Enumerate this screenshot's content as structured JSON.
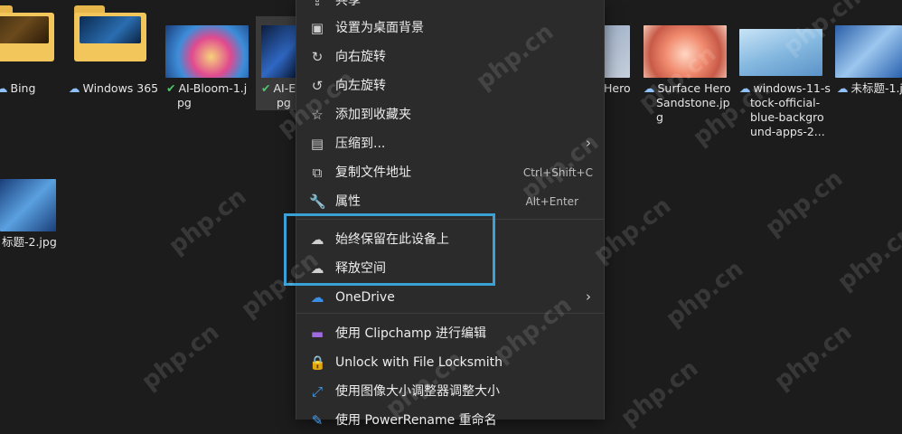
{
  "files": [
    {
      "name": "Bing",
      "icon": "cloud"
    },
    {
      "name": "Windows 365",
      "icon": "cloud"
    },
    {
      "name": "AI-Bloom-1.j",
      "name2": "pg",
      "icon": "check"
    },
    {
      "name": "AI-E",
      "name2": "pg",
      "icon": "check"
    },
    {
      "name": "Hero",
      "icon": ""
    },
    {
      "name": "Surface Hero",
      "name2": "Sandstone.jp",
      "name3": "g",
      "icon": "cloud"
    },
    {
      "name": "windows-11-s",
      "name2": "tock-official-",
      "name3": "blue-backgro",
      "name4": "und-apps-2...",
      "icon": "cloud"
    },
    {
      "name": "未标题-1.j",
      "icon": "cloud"
    },
    {
      "name": "标题-2.jpg",
      "icon": ""
    }
  ],
  "menu": {
    "items": [
      {
        "label": "共享",
        "icon": "share-icon"
      },
      {
        "label": "设置为桌面背景",
        "icon": "wallpaper-icon"
      },
      {
        "label": "向右旋转",
        "icon": "rotate-right-icon"
      },
      {
        "label": "向左旋转",
        "icon": "rotate-left-icon"
      },
      {
        "label": "添加到收藏夹",
        "icon": "star-icon"
      },
      {
        "label": "压缩到...",
        "icon": "zip-icon"
      },
      {
        "label": "复制文件地址",
        "icon": "copy-path-icon",
        "shortcut": "Ctrl+Shift+C"
      },
      {
        "label": "属性",
        "icon": "wrench-icon",
        "shortcut": "Alt+Enter"
      },
      {
        "label": "始终保留在此设备上",
        "icon": "cloud-pin-icon"
      },
      {
        "label": "释放空间",
        "icon": "cloud-icon"
      },
      {
        "label": "OneDrive",
        "icon": "onedrive-icon"
      },
      {
        "label": "使用 Clipchamp 进行编辑",
        "icon": "clipchamp-icon"
      },
      {
        "label": "Unlock with File Locksmith",
        "icon": "lock-icon"
      },
      {
        "label": "使用图像大小调整器调整大小",
        "icon": "resize-icon"
      },
      {
        "label": "使用 PowerRename 重命名",
        "icon": "rename-icon"
      }
    ]
  },
  "watermark": "php.cn"
}
